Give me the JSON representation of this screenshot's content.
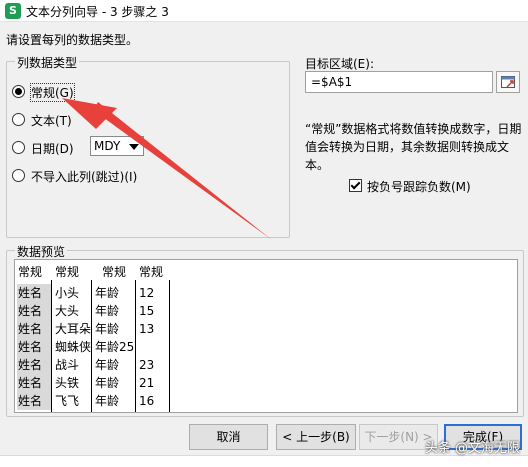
{
  "window": {
    "app_icon": "S",
    "title": "文本分列向导 - 3 步骤之 3"
  },
  "prompt": "请设置每列的数据类型。",
  "column_type": {
    "caption": "列数据类型",
    "options": [
      {
        "label": "常规(G)",
        "checked": true
      },
      {
        "label": "文本(T)",
        "checked": false
      },
      {
        "label": "日期(D)",
        "checked": false
      },
      {
        "label": "不导入此列(跳过)(I)",
        "checked": false
      }
    ],
    "date_format": "MDY"
  },
  "target": {
    "label": "目标区域(E):",
    "value": "=$A$1",
    "icon": "range-select-icon"
  },
  "description": "“常规”数据格式将数值转换成数字，日期值会转换为日期，其余数据则转换成文本。",
  "negative_checkbox": {
    "label": "按负号跟踪负数(M)",
    "checked": true
  },
  "preview": {
    "caption": "数据预览",
    "headers": [
      "常规",
      "常规",
      "常规",
      "常规"
    ],
    "rows": [
      [
        "姓名",
        "小头",
        "年龄",
        "12"
      ],
      [
        "姓名",
        "大头",
        "年龄",
        "15"
      ],
      [
        "姓名",
        "大耳朵",
        "年龄",
        "13"
      ],
      [
        "姓名",
        "蜘蛛侠",
        "年龄25",
        ""
      ],
      [
        "姓名",
        "战斗",
        "年龄",
        "23"
      ],
      [
        "姓名",
        "头铁",
        "年龄",
        "21"
      ],
      [
        "姓名",
        "飞飞",
        "年龄",
        "16"
      ]
    ]
  },
  "buttons": {
    "cancel": "取消",
    "back": "< 上一步(B)",
    "next": "下一步(N) >",
    "finish": "完成(F)"
  },
  "watermark": "头条 @文海无限",
  "colors": {
    "annotation_arrow": "#e8413c",
    "default_button_border": "#2a6fd6"
  }
}
